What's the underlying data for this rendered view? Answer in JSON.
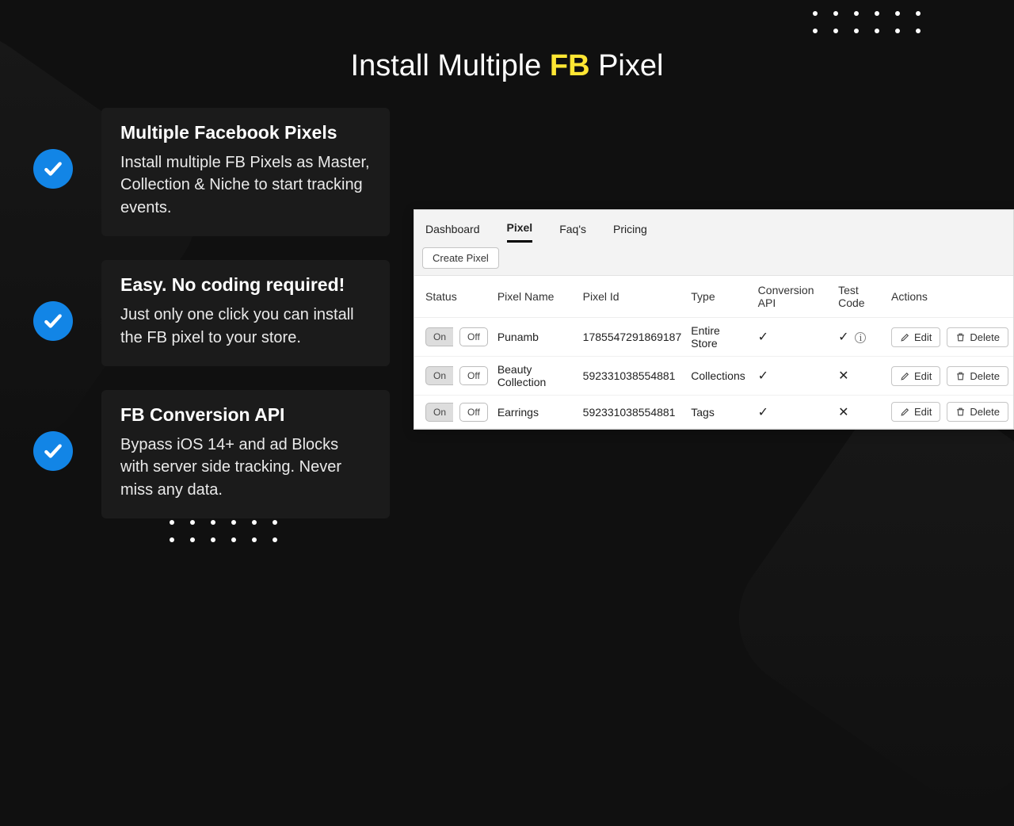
{
  "heading": {
    "pre": "Install Multiple ",
    "highlight": "FB",
    "post": " Pixel"
  },
  "features": [
    {
      "title": "Multiple Facebook Pixels",
      "body": "Install multiple FB Pixels as Master, Collection & Niche to start tracking events."
    },
    {
      "title": "Easy. No coding required!",
      "body": "Just only one click you can install the FB pixel to your store."
    },
    {
      "title": "FB Conversion API",
      "body": "Bypass iOS 14+ and ad Blocks with server side tracking. Never miss any data."
    }
  ],
  "panel": {
    "tabs": [
      "Dashboard",
      "Pixel",
      "Faq's",
      "Pricing"
    ],
    "active_tab": 1,
    "create_button": "Create Pixel",
    "headers": [
      "Status",
      "Pixel Name",
      "Pixel Id",
      "Type",
      "Conversion API",
      "Test Code",
      "Actions"
    ],
    "toggle_on": "On",
    "toggle_off": "Off",
    "edit_label": "Edit",
    "delete_label": "Delete",
    "rows": [
      {
        "status": "on",
        "name": "Punamb",
        "id": "1785547291869187",
        "type": "Entire Store",
        "capi": true,
        "test": "ok_info"
      },
      {
        "status": "on",
        "name": "Beauty Collection",
        "id": "592331038554881",
        "type": "Collections",
        "capi": true,
        "test": "no"
      },
      {
        "status": "on",
        "name": "Earrings",
        "id": "592331038554881",
        "type": "Tags",
        "capi": true,
        "test": "no"
      }
    ]
  }
}
